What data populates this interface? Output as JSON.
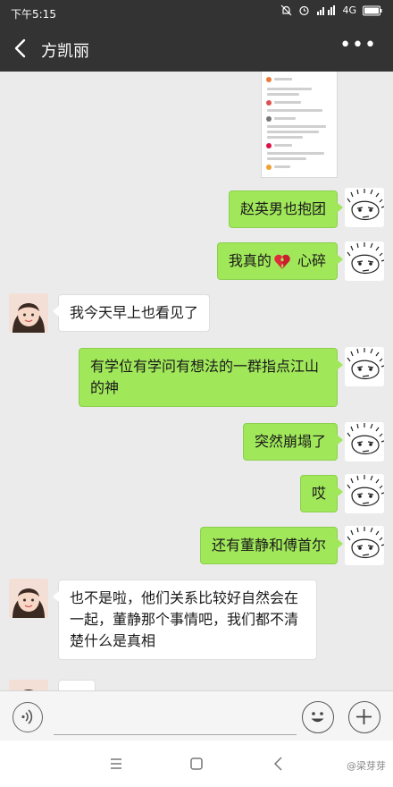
{
  "status_bar": {
    "time": "下午5:15",
    "network": "4G"
  },
  "header": {
    "contact_name": "方凯丽"
  },
  "messages": [
    {
      "side": "right",
      "text": "赵英男也抱团"
    },
    {
      "side": "right",
      "text_before": "我真的",
      "emoji": "broken-heart",
      "text_after": " 心碎"
    },
    {
      "side": "left",
      "text": "我今天早上也看见了"
    },
    {
      "side": "right",
      "text": "有学位有学问有想法的一群指点江山的神"
    },
    {
      "side": "right",
      "text": "突然崩塌了"
    },
    {
      "side": "right",
      "text": "哎"
    },
    {
      "side": "right",
      "text": "还有董静和傅首尔"
    },
    {
      "side": "left",
      "text": "也不是啦，他们关系比较好自然会在一起，董静那个事情吧，我们都不清楚什么是真相"
    },
    {
      "side": "left",
      "text": ""
    }
  ],
  "input": {
    "value": ""
  },
  "watermark": "@梁芽芽",
  "colors": {
    "bubble_self": "#a0e75a",
    "bubble_other": "#ffffff",
    "header": "#333333",
    "background": "#ebebeb"
  },
  "icons": [
    "chevron-left-icon",
    "more-icon",
    "voice-icon",
    "emoji-icon",
    "plus-icon",
    "menu-icon",
    "home-square-icon",
    "back-nav-icon",
    "broken-heart-icon",
    "mute-icon",
    "alarm-icon",
    "signal-icon"
  ]
}
